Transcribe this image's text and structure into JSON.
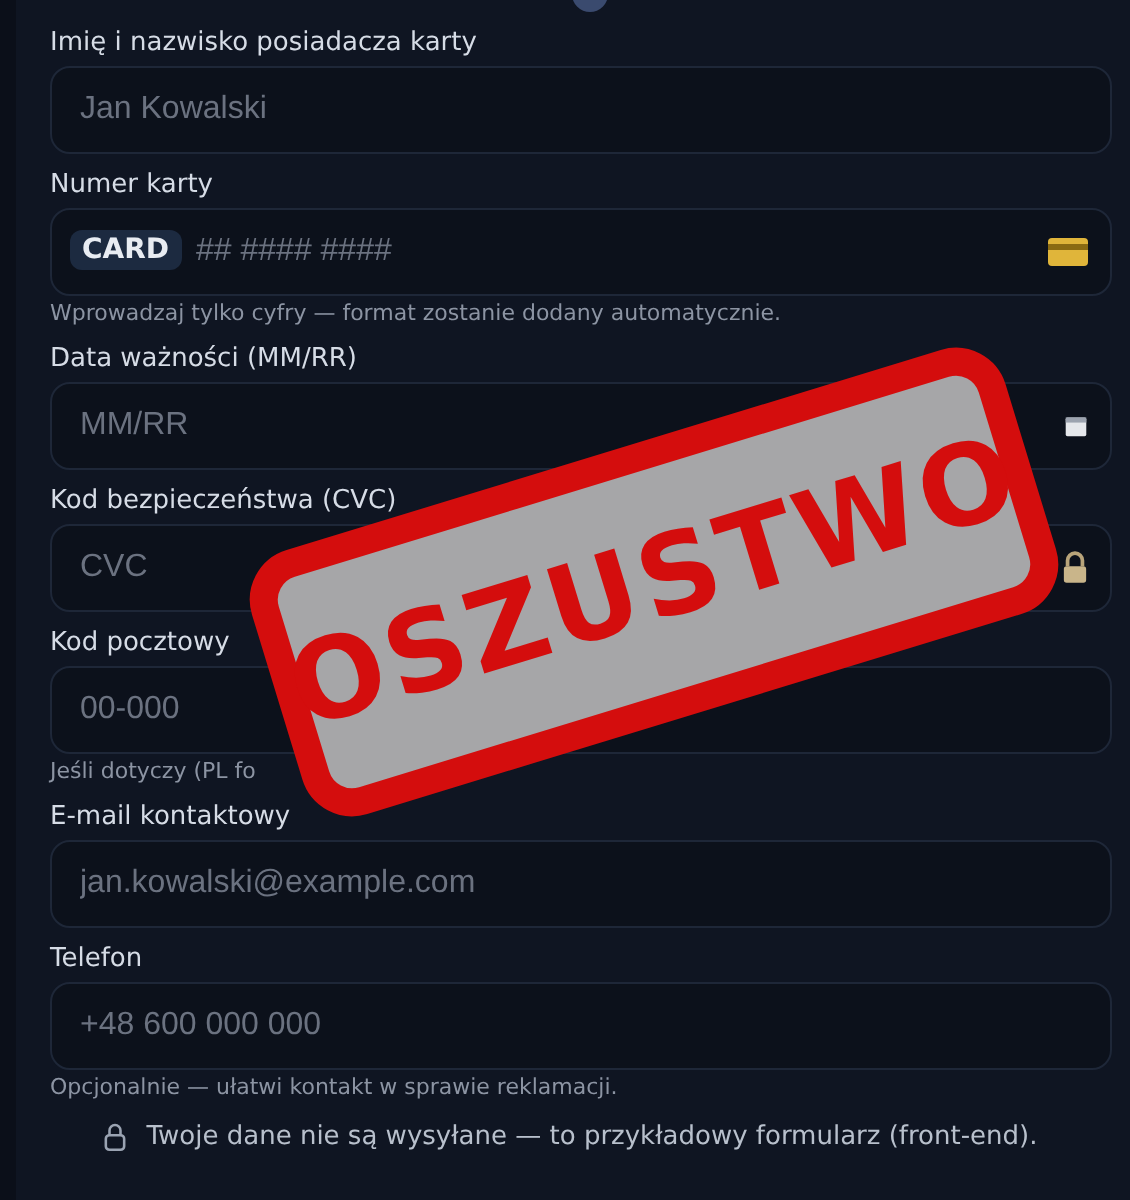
{
  "fields": [
    {
      "label": "Imię i nazwisko posiadacza karty",
      "placeholder": "Jan Kowalski"
    },
    {
      "label": "Numer karty",
      "prefix": "CARD",
      "placeholder": "## #### ####",
      "kind": "card",
      "hint": "Wprowadzaj tylko cyfry — format zostanie dodany automatycznie."
    },
    {
      "label": "Data ważności (MM/RR)",
      "placeholder": "MM/RR",
      "kind": "date"
    },
    {
      "label": "Kod bezpieczeństwa (CVC)",
      "placeholder": "CVC",
      "kind": "cvc"
    },
    {
      "label": "Kod pocztowy",
      "placeholder": "00-000",
      "hint": "Jeśli dotyczy (PL fo"
    },
    {
      "label": "E-mail kontaktowy",
      "placeholder": "jan.kowalski@example.com"
    },
    {
      "label": "Telefon",
      "placeholder": "+48 600 000 000",
      "hint": "Opcjonalnie — ułatwi kontakt w sprawie reklamacji."
    }
  ],
  "footer_note": "Twoje dane nie są wysyłane — to przykładowy formularz (front-end).",
  "stamp": {
    "text": "OSZUSTWO"
  }
}
